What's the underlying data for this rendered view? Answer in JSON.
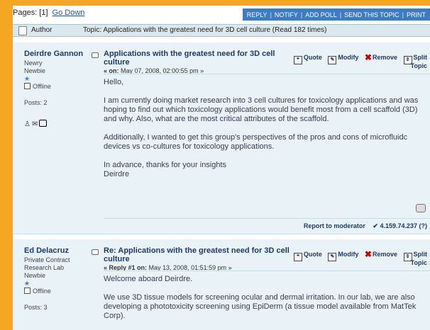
{
  "topbar": {
    "pages_label": "Pages: [1]",
    "go_down": "Go Down",
    "buttons": [
      "REPLY",
      "NOTIFY",
      "ADD POLL",
      "SEND THIS TOPIC",
      "PRINT"
    ]
  },
  "header": {
    "author_label": "Author",
    "topic_label": "Topic: Applications with the greatest need for 3D cell culture  (Read 182 times)"
  },
  "actions": {
    "quote": "Quote",
    "modify": "Modify",
    "remove": "Remove",
    "split": "Split",
    "topic": "Topic"
  },
  "posts": [
    {
      "author": "Deirdre Gannon",
      "rank_lines": [
        "Newry",
        "Newbie"
      ],
      "status": "Offline",
      "post_count": "Posts: 2",
      "subject": "Applications with the greatest need for 3D cell culture",
      "date_prefix": "« on:",
      "date": "May 07, 2008, 02:00:55 pm »",
      "body": [
        "Hello,",
        "I am currently doing market research into 3 cell cultures for toxicology applications and was hoping to find out which toxicology applications would benefit most from a cell scaffold (3D) and why.  Also, what are the most critical attributes of the scaffold.",
        "Additionally, I wanted to get this group's perspectives of the pros and cons of microfluidc devices vs co-cultures for toxicology applications.",
        "In advance, thanks for your insights\nDeirdre"
      ],
      "report": "Report to moderator",
      "ip": "✔ 4.159.74.237 (?)"
    },
    {
      "author": "Ed Delacruz",
      "rank_lines": [
        "Private Contract",
        "Research Lab",
        "Newbie"
      ],
      "status": "Offline",
      "post_count": "Posts: 3",
      "subject": "Re: Applications with the greatest need for 3D cell culture",
      "date_prefix": "« Reply #1 on:",
      "date": "May 13, 2008, 01:51:59 pm »",
      "body": [
        "Welcome aboard Deirdre.",
        "We use 3D tissue models for screening ocular and dermal irritation.  In our lab, we are also developing a phototoxicity screening using EpiDerm (a tissue model available from MatTek Corp)."
      ]
    }
  ],
  "colors": {
    "accent": "#3f7bbf",
    "frame": "#f5a623",
    "post_bg": "#e9f3f7",
    "header_bg": "#dbe8ee",
    "author_name": "#1b3a6b"
  }
}
